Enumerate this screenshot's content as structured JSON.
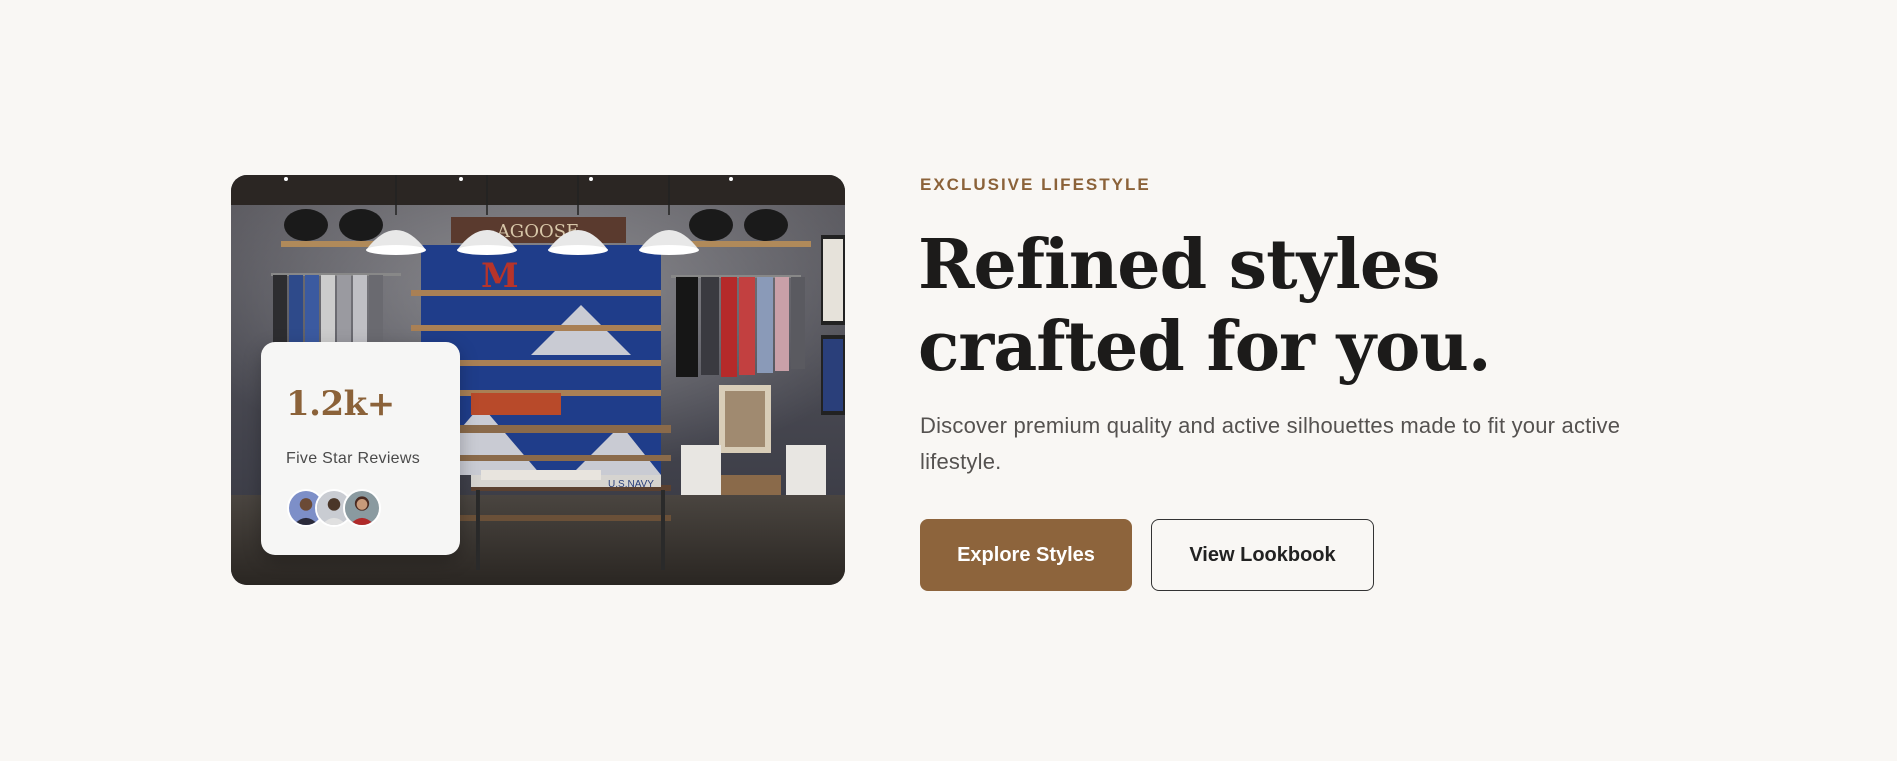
{
  "hero": {
    "eyebrow": "EXCLUSIVE LIFESTYLE",
    "headline": "Refined styles crafted for you.",
    "subtext": "Discover premium quality and active silhouettes made to fit your active lifestyle.",
    "primary_button": "Explore Styles",
    "secondary_button": "View Lookbook"
  },
  "image": {
    "subject": "clothing store interior"
  },
  "review_card": {
    "count": "1.2k+",
    "label": "Five Star Reviews",
    "avatars": [
      "avatar-1",
      "avatar-2",
      "avatar-3"
    ]
  },
  "colors": {
    "background": "#f9f7f4",
    "accent": "#8d643c",
    "heading": "#1c1b1a",
    "body_text": "#555250"
  }
}
